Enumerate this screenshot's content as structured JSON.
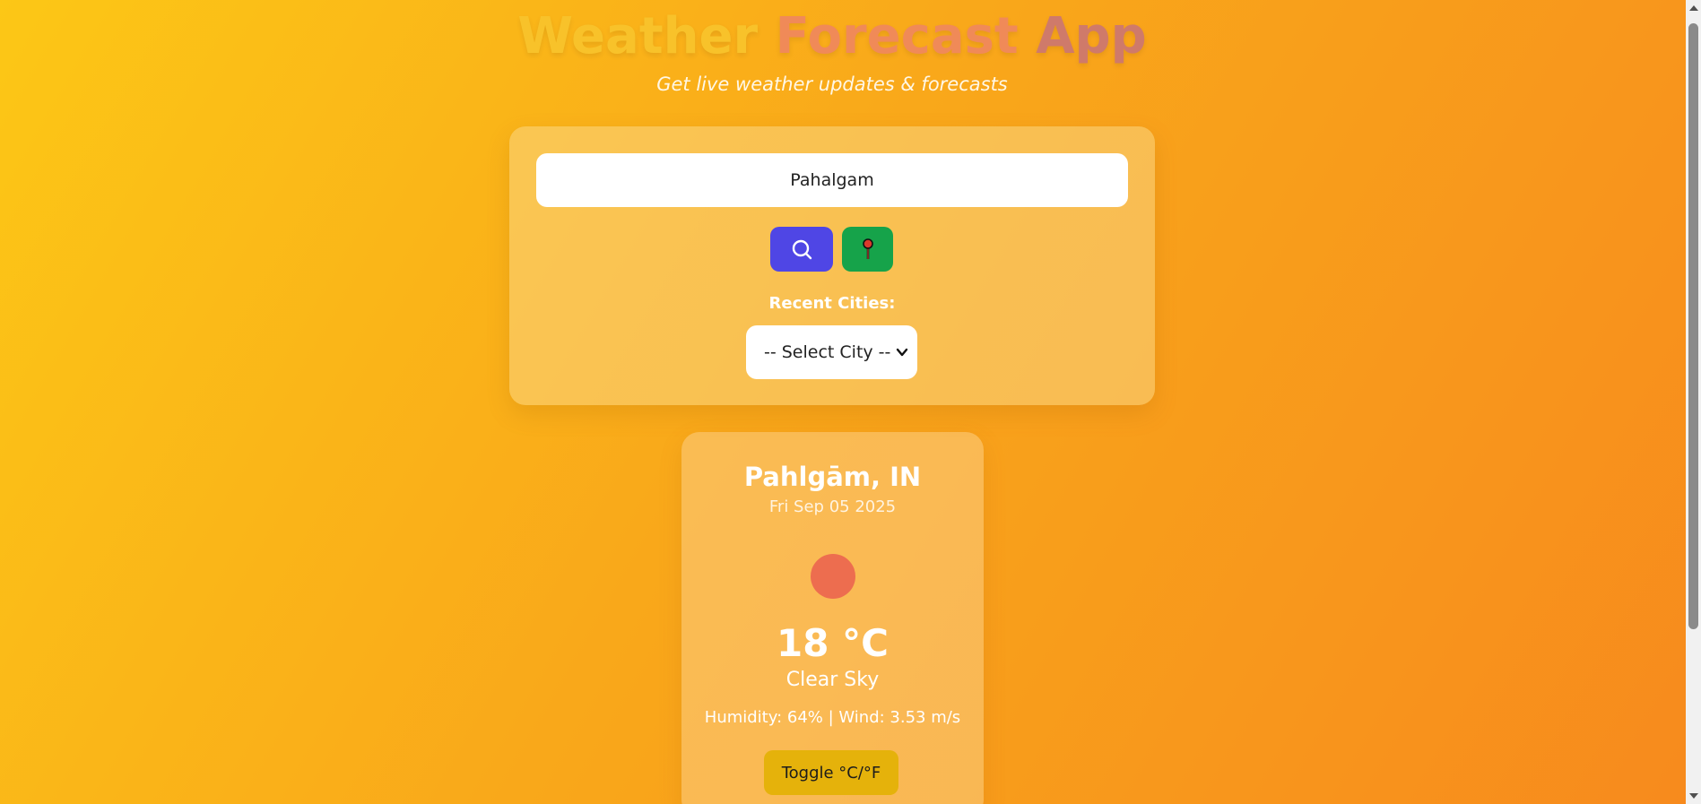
{
  "header": {
    "title_words": [
      "Weather",
      "Forecast",
      "App"
    ],
    "subtitle": "Get live weather updates & forecasts"
  },
  "search": {
    "input_value": "Pahalgam",
    "search_icon": "search-icon",
    "location_icon": "location-pin-icon",
    "recent_label": "Recent Cities:",
    "select_value": "-- Select City --"
  },
  "weather": {
    "city": "Pahlgām, IN",
    "date": "Fri Sep 05 2025",
    "icon": "sun-icon",
    "temperature": "18 °C",
    "description": "Clear Sky",
    "details": "Humidity: 64% | Wind: 3.53 m/s",
    "toggle_label": "Toggle °C/°F"
  },
  "colors": {
    "search_button": "#4f46e5",
    "location_button": "#16a34a",
    "toggle_button": "#e5b20b",
    "sun": "#ed6d4f"
  }
}
